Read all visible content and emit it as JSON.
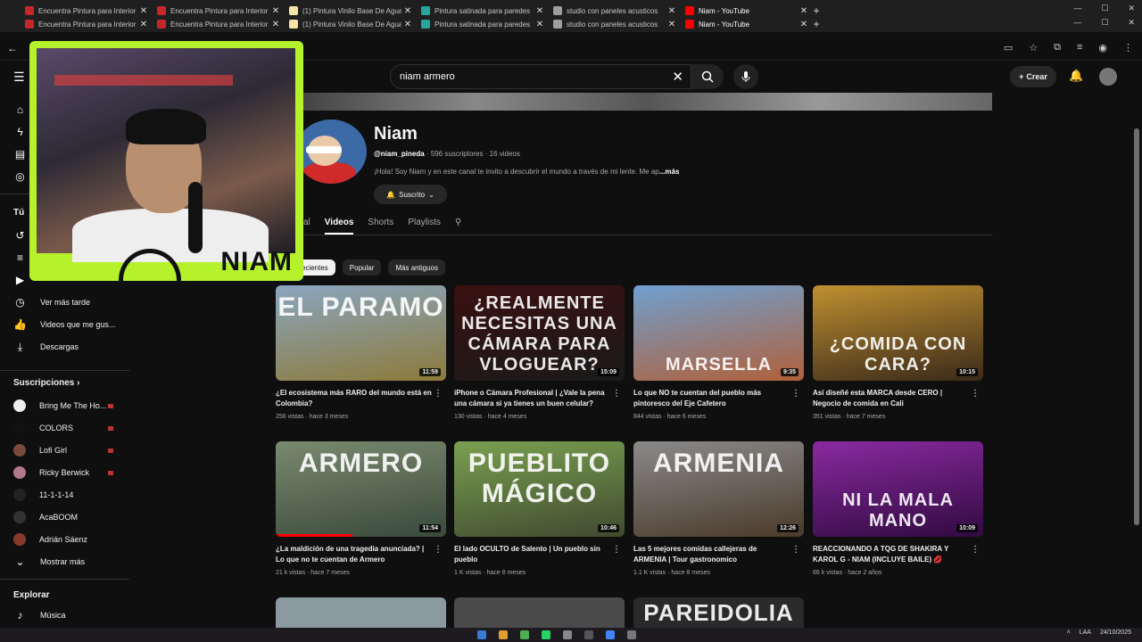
{
  "browser": {
    "tabs": [
      {
        "title": "Encuentra Pintura para Interior",
        "color": "#c62828",
        "active": false
      },
      {
        "title": "Encuentra Pintura para Interior",
        "color": "#c62828",
        "active": false
      },
      {
        "title": "(1) Pintura Vinilo Base De Agua",
        "color": "#f5e6a8",
        "active": false
      },
      {
        "title": "Pintura satinada para paredes",
        "color": "#26a69a",
        "active": false
      },
      {
        "title": "studio con paneles acusticos",
        "color": "#9e9e9e",
        "active": false
      },
      {
        "title": "Niam - YouTube",
        "color": "#ff0000",
        "active": true
      }
    ],
    "close_symbol": "✕",
    "new_tab": "+"
  },
  "youtube": {
    "search_query": "niam armero",
    "create_label": "Crear"
  },
  "sidebar": {
    "you_header": "Tú",
    "items": [
      {
        "label": "Ver más tarde",
        "icon": "clock-icon"
      },
      {
        "label": "Videos que me gus...",
        "icon": "thumbs-up-icon"
      },
      {
        "label": "Descargas",
        "icon": "download-icon"
      }
    ],
    "subs_header": "Suscripciones",
    "subscriptions": [
      {
        "name": "Bring Me The Ho...",
        "color": "#eeeeee",
        "live": true
      },
      {
        "name": "COLORS",
        "color": "#111111",
        "live": true
      },
      {
        "name": "Lofi Girl",
        "color": "#7a4a3a",
        "live": true
      },
      {
        "name": "Ricky Berwick",
        "color": "#b07a8a",
        "live": true
      },
      {
        "name": "11-1-1-14",
        "color": "#222222",
        "live": false
      },
      {
        "name": "AcaBOOM",
        "color": "#333333",
        "live": false
      },
      {
        "name": "Adrián Sáenz",
        "color": "#8a3a2a",
        "live": false
      }
    ],
    "show_more": "Mostrar más",
    "explore_header": "Explorar",
    "explore_items": [
      {
        "label": "Música",
        "icon": "music-note-icon"
      }
    ]
  },
  "webcam": {
    "brand": "NIAM"
  },
  "channel": {
    "name": "Niam",
    "handle": "@niam_pineda",
    "stats": " · 596 suscriptores · 16 videos",
    "description": "¡Hola! Soy Niam y en este canal te invito a descubrir el mundo a través de mi lente. Me ap",
    "more": "...más",
    "subscribe_label": "Suscrito",
    "tabs": [
      "al",
      "Videos",
      "Shorts",
      "Playlists"
    ],
    "active_tab": "Videos"
  },
  "chips": [
    "ecientes",
    "Popular",
    "Más antiguos"
  ],
  "videos": [
    {
      "title": "¿El ecosistema más RARO del mundo está en Colombia?",
      "meta": "256 vistas · hace 3 meses",
      "duration": "11:59",
      "thumb_text": "EL PARAMO",
      "text_pos": "top",
      "c1": "#8aa6c0",
      "c2": "#8c7a3a",
      "progress": 0.0
    },
    {
      "title": "iPhone o Cámara Profesional | ¿Vale la pena una cámara si ya tienes un buen celular?",
      "meta": "130 vistas · hace 4 meses",
      "duration": "15:09",
      "thumb_text": "¿REALMENTE NECESITAS UNA CÁMARA PARA VLOGUEAR?",
      "text_pos": "bottom",
      "c1": "#3a1010",
      "c2": "#1a1a1a",
      "progress": 0.0
    },
    {
      "title": "Lo que NO te cuentan del pueblo más pintoresco del Eje Cafetero",
      "meta": "844 vistas · hace 6 meses",
      "duration": "9:35",
      "thumb_text": "MARSELLA",
      "text_pos": "bottom",
      "c1": "#6fa0d0",
      "c2": "#b0603a",
      "progress": 0.0
    },
    {
      "title": "Así diseñé esta MARCA desde CERO | Negocio de comida en Cali",
      "meta": "351 vistas · hace 7 meses",
      "duration": "10:15",
      "thumb_text": "¿COMIDA CON CARA?",
      "text_pos": "bottom",
      "c1": "#c09030",
      "c2": "#3a2a1a",
      "progress": 0.0
    },
    {
      "title": "¿La maldición de una tragedia anunciada? | Lo que no te cuentan de Armero",
      "meta": "21 k vistas · hace 7 meses",
      "duration": "11:54",
      "thumb_text": "ARMERO",
      "text_pos": "top",
      "c1": "#7a8a70",
      "c2": "#3a4a3a",
      "progress": 0.45
    },
    {
      "title": "El lado OCULTO de Salento | Un pueblo sin pueblo",
      "meta": "1 K vistas · hace 8 meses",
      "duration": "10:46",
      "thumb_text": "PUEBLITO MÁGICO",
      "text_pos": "top",
      "c1": "#7aa050",
      "c2": "#404a30",
      "progress": 0.0
    },
    {
      "title": "Las 5 mejores comidas callejeras de ARMENIA | Tour gastronomico",
      "meta": "1.1 K vistas · hace 8 meses",
      "duration": "12:26",
      "thumb_text": "ARMENIA",
      "text_pos": "top",
      "c1": "#8a8a8a",
      "c2": "#4a3a2a",
      "progress": 0.0
    },
    {
      "title": "REACCIONANDO A TQG DE SHAKIRA Y KAROL G - NIAM (INCLUYE BAILE) 💋",
      "meta": "66 k vistas · hace 2 años",
      "duration": "10:09",
      "thumb_text": "NI LA MALA MANO",
      "text_pos": "bottom",
      "c1": "#8a2aa0",
      "c2": "#300a40",
      "progress": 0.0
    }
  ],
  "row3": [
    {
      "thumb_text": ""
    },
    {
      "thumb_text": ""
    },
    {
      "thumb_text": "PAREIDOLIA"
    }
  ],
  "taskbar": {
    "lang": "LAA",
    "date": "24/10/2025"
  }
}
